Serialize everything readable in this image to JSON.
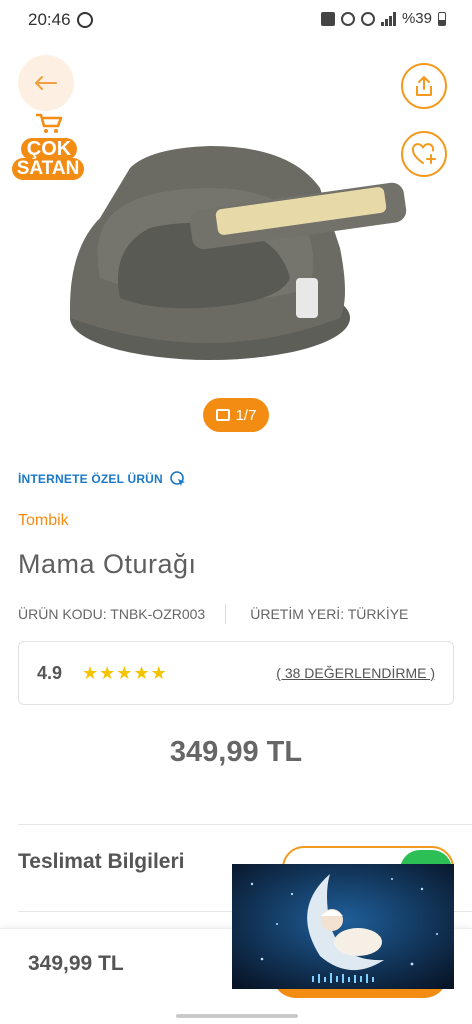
{
  "status_bar": {
    "time": "20:46",
    "battery": "%39"
  },
  "icons": {
    "back": "arrow-left-icon",
    "share": "share-icon",
    "favorite": "heart-plus-icon",
    "gallery": "image-icon",
    "internet_only": "cursor-click-icon",
    "cart": "cart-icon"
  },
  "colors": {
    "accent": "#f28c13",
    "link": "#1a79c8",
    "star": "#f5c400",
    "whatsapp": "#2cbf55"
  },
  "badge": {
    "line1": "ÇOK",
    "line2": "SATAN"
  },
  "gallery": {
    "counter": "1/7"
  },
  "product": {
    "internet_only_label": "İNTERNETE ÖZEL ÜRÜN",
    "brand": "Tombik",
    "name": "Mama Oturağı",
    "code": "ÜRÜN KODU: TNBK-OZR003",
    "origin": "ÜRETİM YERİ: TÜRKİYE",
    "rating": "4.9",
    "stars": "★★★★★",
    "star_count": 5,
    "reviews": "( 38 DEĞERLENDİRME )",
    "price": "349,99 TL"
  },
  "delivery": {
    "title": "Teslimat Bilgileri"
  },
  "bottom_bar": {
    "price": "349,99 TL"
  }
}
